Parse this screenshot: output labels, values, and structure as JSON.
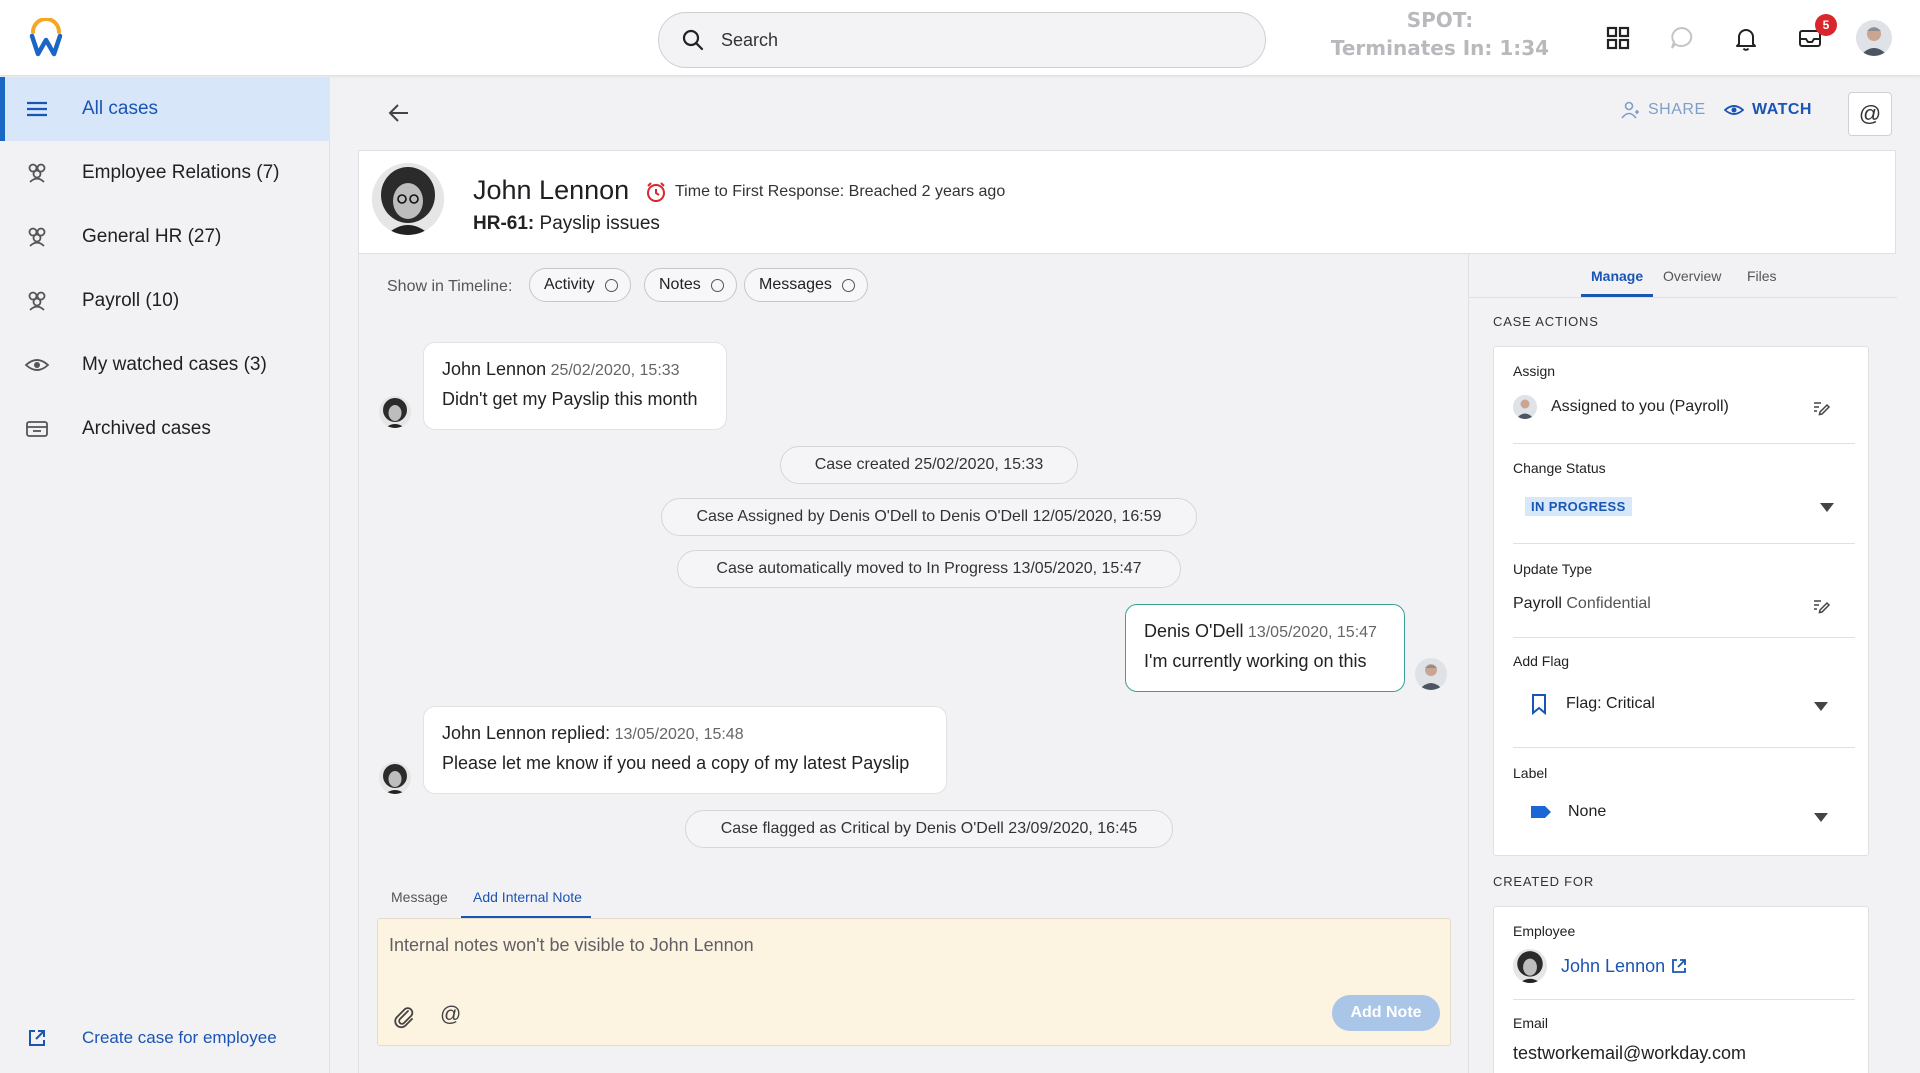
{
  "topbar": {
    "search_placeholder": "Search",
    "spot_line1": "SPOT:",
    "spot_line2": "Terminates In: 1:34",
    "inbox_count": "5"
  },
  "sidebar": {
    "items": [
      {
        "label": "All cases"
      },
      {
        "label": "Employee Relations (7)"
      },
      {
        "label": "General HR (27)"
      },
      {
        "label": "Payroll (10)"
      },
      {
        "label": "My watched cases (3)"
      },
      {
        "label": "Archived cases"
      }
    ],
    "create_case": "Create case for employee"
  },
  "actions": {
    "share": "SHARE",
    "watch": "WATCH",
    "mention": "@"
  },
  "case": {
    "name": "John Lennon",
    "sla": "Time to First Response: Breached 2 years ago",
    "id": "HR-61:",
    "subject": "Payslip issues"
  },
  "timeline": {
    "filter_label": "Show in Timeline:",
    "filters": [
      "Activity",
      "Notes",
      "Messages"
    ],
    "msg1": {
      "who": "John Lennon",
      "when": "25/02/2020, 15:33",
      "text": "Didn't get my Payslip this month"
    },
    "events": [
      "Case created 25/02/2020, 15:33",
      "Case Assigned by Denis O'Dell to Denis O'Dell 12/05/2020, 16:59",
      "Case automatically moved to In Progress 13/05/2020, 15:47",
      "Case flagged as Critical by Denis O'Dell 23/09/2020, 16:45"
    ],
    "msg2": {
      "who": "Denis O'Dell",
      "when": "13/05/2020, 15:47",
      "text": "I'm currently working on this"
    },
    "msg3": {
      "who": "John Lennon replied:",
      "when": "13/05/2020, 15:48",
      "text": "Please let me know if you need a copy of my latest Payslip"
    }
  },
  "composer": {
    "tabs": [
      "Message",
      "Add Internal Note"
    ],
    "placeholder": "Internal notes won't be visible to John Lennon",
    "mention": "@",
    "submit": "Add Note"
  },
  "panel": {
    "tabs": [
      "Manage",
      "Overview",
      "Files"
    ],
    "case_actions_title": "CASE ACTIONS",
    "assign_label": "Assign",
    "assign_value": "Assigned to you (Payroll)",
    "status_label": "Change Status",
    "status_value": "IN PROGRESS",
    "update_label": "Update Type",
    "update_value_a": "Payroll",
    "update_value_b": "Confidential",
    "flag_label": "Add Flag",
    "flag_value": "Flag: Critical",
    "label_label": "Label",
    "label_value": "None",
    "created_for_title": "CREATED FOR",
    "employee_label": "Employee",
    "employee_value": "John Lennon",
    "email_label": "Email",
    "email_value": "testworkemail@workday.com"
  },
  "colors": {
    "accent": "#1a55b3",
    "active_nav_bg": "#d7e6f8",
    "my_message_border": "#3aa096",
    "note_bg": "#fcf3e1",
    "badge": "#d8262c"
  }
}
